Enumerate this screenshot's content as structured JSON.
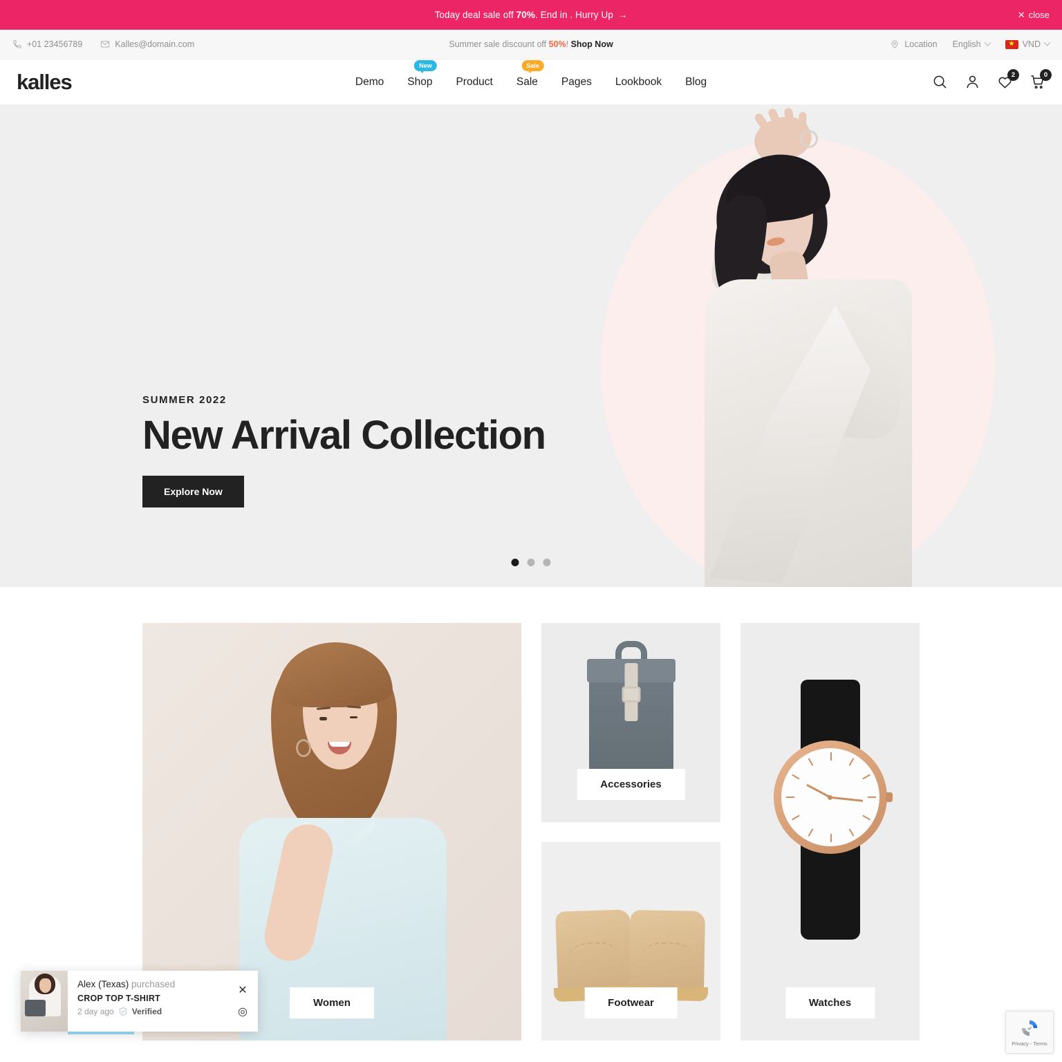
{
  "announcement": {
    "text_before": "Today deal sale off ",
    "percent": "70%",
    "text_after": ". End in . Hurry Up ",
    "arrow": "→",
    "close_label": "close",
    "close_icon": "✕",
    "bg_color": "#ec2566"
  },
  "utility": {
    "phone": "+01 23456789",
    "email": "Kalles@domain.com",
    "promo_before": "Summer sale discount off ",
    "promo_percent": "50%",
    "promo_excl": "! ",
    "promo_cta": "Shop Now",
    "location": "Location",
    "language": "English",
    "currency": "VND",
    "flag_star": "★",
    "promo_percent_color": "#f4653e"
  },
  "header": {
    "logo": "kalles",
    "nav": [
      {
        "label": "Demo",
        "badge": ""
      },
      {
        "label": "Shop",
        "badge": "New",
        "badge_color": "#2bb9e4"
      },
      {
        "label": "Product",
        "badge": ""
      },
      {
        "label": "Sale",
        "badge": "Sale",
        "badge_color": "#fbaa28"
      },
      {
        "label": "Pages",
        "badge": ""
      },
      {
        "label": "Lookbook",
        "badge": ""
      },
      {
        "label": "Blog",
        "badge": ""
      }
    ],
    "wishlist_count": "2",
    "cart_count": "0"
  },
  "hero": {
    "eyebrow": "SUMMER 2022",
    "title": "New Arrival Collection",
    "button": "Explore Now",
    "slide_count": 3,
    "active_slide": 1,
    "circle_color": "#fdeeee",
    "bg_color": "#efefef"
  },
  "categories": {
    "women": "Women",
    "accessories": "Accessories",
    "footwear": "Footwear",
    "watches": "Watches"
  },
  "notification": {
    "customer": "Alex (Texas)",
    "action": " purchased",
    "product": "CROP TOP T-SHIRT",
    "time": "2 day ago",
    "verified": "Verified",
    "close_icon": "✕",
    "view_icon": "◎"
  },
  "recaptcha": {
    "text": "Privacy - Terms"
  }
}
